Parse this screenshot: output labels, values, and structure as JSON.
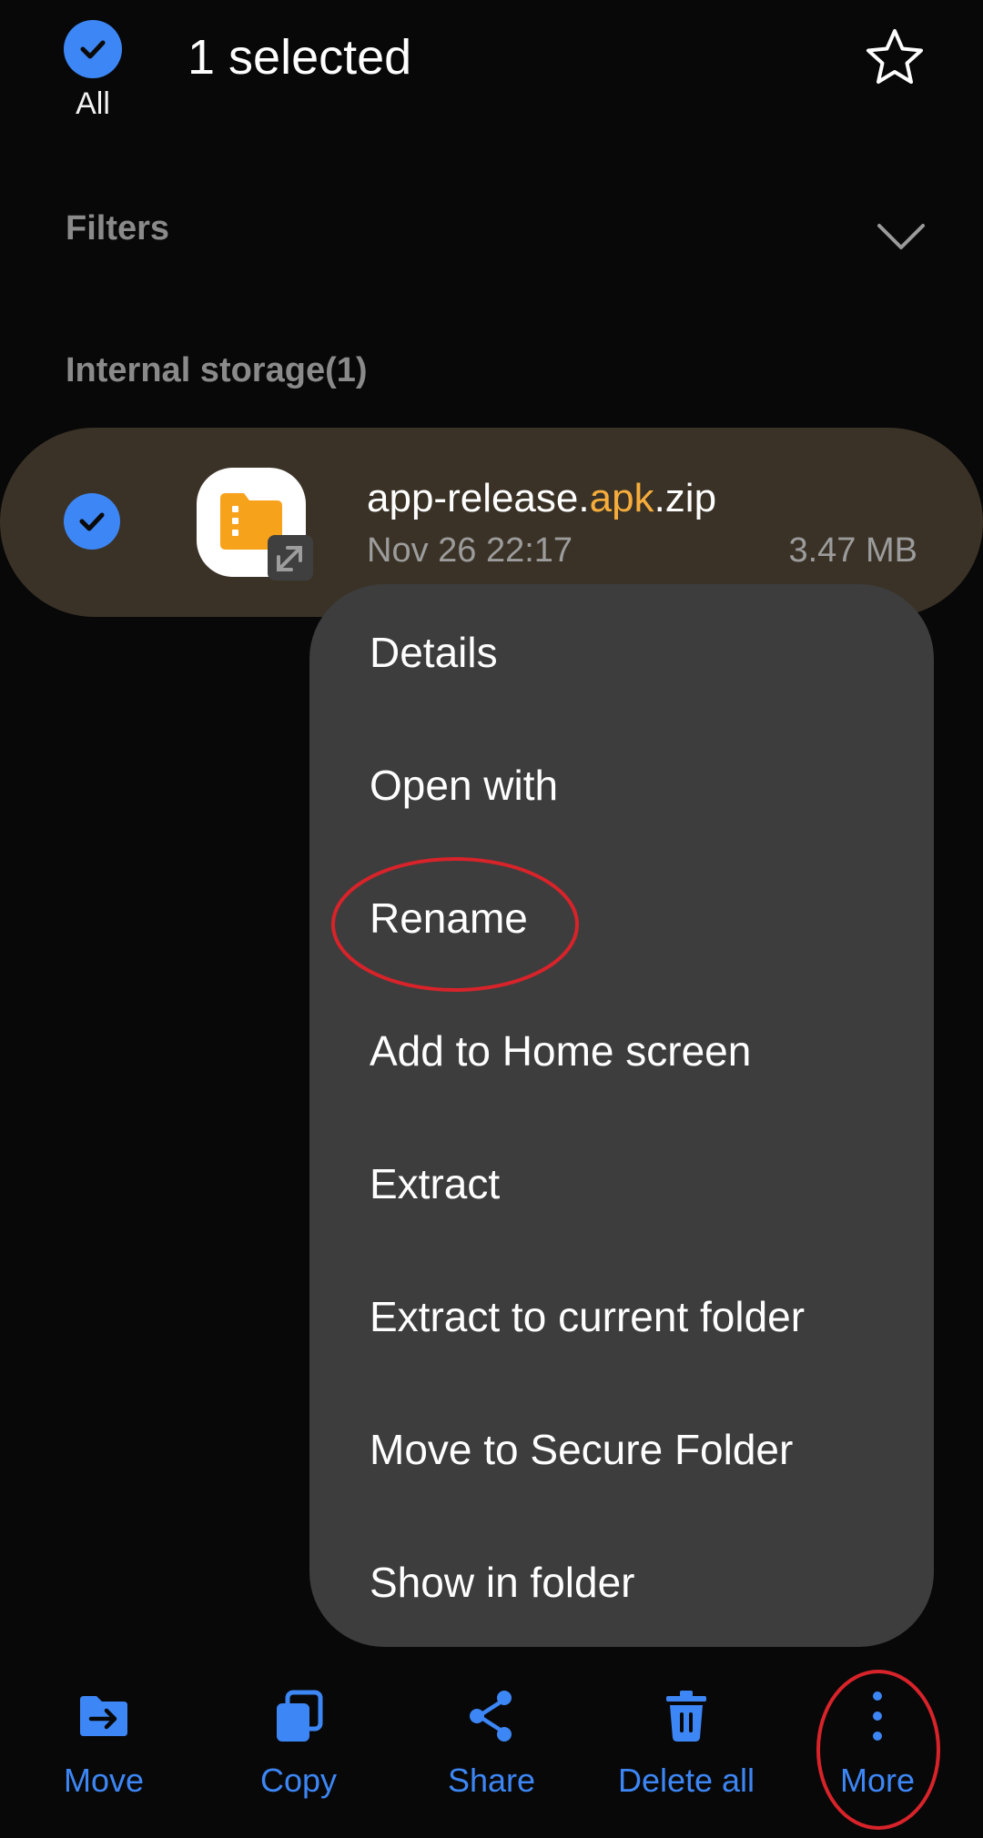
{
  "header": {
    "select_all_label": "All",
    "title": "1 selected"
  },
  "filters": {
    "label": "Filters"
  },
  "section": {
    "title": "Internal storage(1)"
  },
  "file": {
    "name_prefix": "app-release.",
    "name_highlight": "apk",
    "name_suffix": ".zip",
    "date": "Nov 26 22:17",
    "size": "3.47 MB",
    "icon": "compressed-folder-icon"
  },
  "context_menu": {
    "items": [
      {
        "label": "Details"
      },
      {
        "label": "Open with"
      },
      {
        "label": "Rename"
      },
      {
        "label": "Add to Home screen"
      },
      {
        "label": "Extract"
      },
      {
        "label": "Extract to current folder"
      },
      {
        "label": "Move to Secure Folder"
      },
      {
        "label": "Show in folder"
      }
    ]
  },
  "bottom_bar": {
    "move": "Move",
    "copy": "Copy",
    "share": "Share",
    "delete_all": "Delete all",
    "more": "More"
  },
  "colors": {
    "accent": "#3d86f5",
    "highlight": "#f6ad3c",
    "annotation": "#d8232a",
    "selected_row": "#3a3226",
    "menu_bg": "#3d3d3d"
  }
}
